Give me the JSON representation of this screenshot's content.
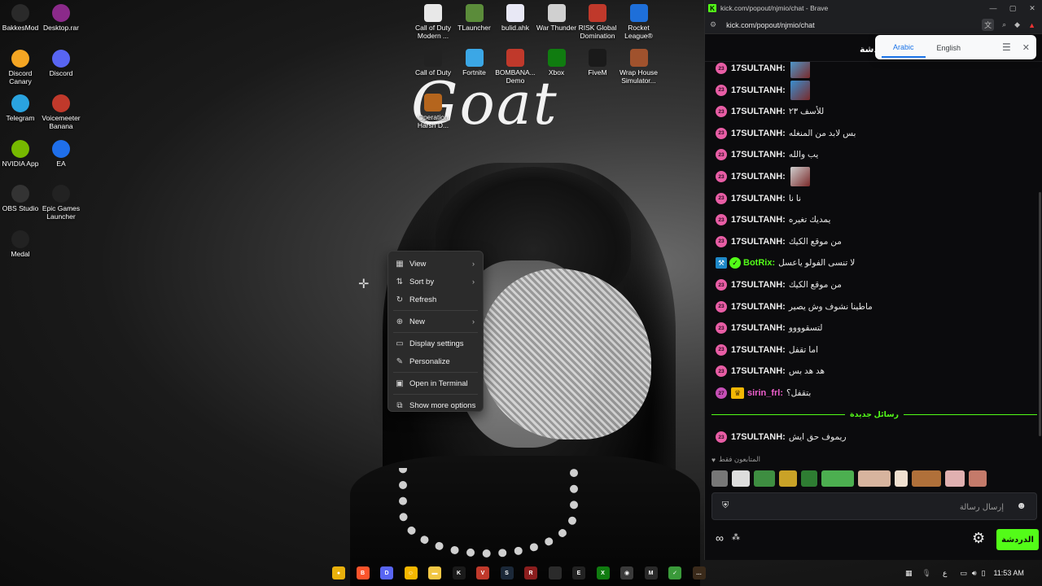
{
  "desktop": {
    "left_icons": [
      {
        "label": "BakkesMod",
        "icon": "bakkesmod-icon",
        "color": "#2a2a2a"
      },
      {
        "label": "Desktop.rar",
        "icon": "winrar-icon",
        "color": "#8b2a8a"
      },
      {
        "label": "Discord Canary",
        "icon": "discord-canary-icon",
        "color": "#f5a623"
      },
      {
        "label": "Discord",
        "icon": "discord-icon",
        "color": "#5865f2"
      },
      {
        "label": "Telegram",
        "icon": "telegram-icon",
        "color": "#2aa3df"
      },
      {
        "label": "Voicemeeter Banana",
        "icon": "voicemeeter-icon",
        "color": "#c0392b"
      },
      {
        "label": "NVIDIA App",
        "icon": "nvidia-icon",
        "color": "#76b900"
      },
      {
        "label": "EA",
        "icon": "ea-icon",
        "color": "#1f6feb"
      },
      {
        "label": "OBS Studio",
        "icon": "obs-icon",
        "color": "#333333"
      },
      {
        "label": "Epic Games Launcher",
        "icon": "epic-games-icon",
        "color": "#222222"
      },
      {
        "label": "Medal",
        "icon": "medal-icon",
        "color": "#222222"
      }
    ],
    "top_icons": [
      {
        "label": "Call of Duty Modern ...",
        "icon": "document-icon",
        "color": "#e8e8e8"
      },
      {
        "label": "TLauncher",
        "icon": "tlauncher-icon",
        "color": "#5b8c3a"
      },
      {
        "label": "bulid.ahk",
        "icon": "ahk-file-icon",
        "color": "#e8e8f5"
      },
      {
        "label": "War Thunder",
        "icon": "war-thunder-icon",
        "color": "#d0d0d0"
      },
      {
        "label": "RISK Global Domination",
        "icon": "risk-icon",
        "color": "#c0392b"
      },
      {
        "label": "Rocket League®",
        "icon": "rocket-league-icon",
        "color": "#1e6fd9"
      },
      {
        "label": "Call of Duty",
        "icon": "call-of-duty-icon",
        "color": "#222222"
      },
      {
        "label": "Fortnite",
        "icon": "fortnite-icon",
        "color": "#3ba7e6"
      },
      {
        "label": "BOMBANA... Demo",
        "icon": "bombana-icon",
        "color": "#c0392b"
      },
      {
        "label": "Xbox",
        "icon": "xbox-icon",
        "color": "#107c10"
      },
      {
        "label": "FiveM",
        "icon": "fivem-icon",
        "color": "#1a1a1a"
      },
      {
        "label": "Wrap House Simulator...",
        "icon": "wrap-house-icon",
        "color": "#a0522d"
      },
      {
        "label": "Operation Harsh D...",
        "icon": "operation-icon",
        "color": "#b5651d"
      }
    ],
    "wallpaper_text": "Goat"
  },
  "context_menu": {
    "items": [
      {
        "label": "View",
        "icon": "grid-icon",
        "glyph": "▦",
        "submenu": true
      },
      {
        "label": "Sort by",
        "icon": "sort-icon",
        "glyph": "⇅",
        "submenu": true
      },
      {
        "label": "Refresh",
        "icon": "refresh-icon",
        "glyph": "↻",
        "submenu": false
      },
      {
        "label": "New",
        "icon": "new-plus-icon",
        "glyph": "⊕",
        "submenu": true
      },
      {
        "label": "Display settings",
        "icon": "display-icon",
        "glyph": "▭",
        "submenu": false
      },
      {
        "label": "Personalize",
        "icon": "brush-icon",
        "glyph": "✎",
        "submenu": false
      },
      {
        "label": "Open in Terminal",
        "icon": "terminal-icon",
        "glyph": "▣",
        "submenu": false
      },
      {
        "label": "Show more options",
        "icon": "more-options-icon",
        "glyph": "⧉",
        "submenu": false
      }
    ]
  },
  "taskbar": {
    "clock": "11:53 AM",
    "lang": "ع",
    "apps": [
      {
        "icon": "chrome-icon",
        "color": "#e9b10c",
        "glyph": "●"
      },
      {
        "icon": "brave-icon",
        "color": "#fb542b",
        "glyph": "B"
      },
      {
        "icon": "discord-taskbar-icon",
        "color": "#5865f2",
        "glyph": "D"
      },
      {
        "icon": "emoji-app-icon",
        "color": "#f5b700",
        "glyph": "☺"
      },
      {
        "icon": "file-explorer-icon",
        "color": "#f2c744",
        "glyph": "▬"
      },
      {
        "icon": "kick-icon",
        "color": "#1a1a1a",
        "glyph": "K"
      },
      {
        "icon": "voicemeeter-taskbar-icon",
        "color": "#c0392b",
        "glyph": "V"
      },
      {
        "icon": "steam-icon",
        "color": "#1b2838",
        "glyph": "S"
      },
      {
        "icon": "risk-taskbar-icon",
        "color": "#8b1e1e",
        "glyph": "R"
      },
      {
        "icon": "blank-app-icon",
        "color": "#2b2b2b",
        "glyph": ""
      },
      {
        "icon": "epic-taskbar-icon",
        "color": "#222222",
        "glyph": "E"
      },
      {
        "icon": "xbox-taskbar-icon",
        "color": "#107c10",
        "glyph": "X"
      },
      {
        "icon": "obs-taskbar-icon",
        "color": "#3a3a3a",
        "glyph": "◉"
      },
      {
        "icon": "medal-taskbar-icon",
        "color": "#2a2a2a",
        "glyph": "M"
      },
      {
        "icon": "tlauncher-taskbar-icon",
        "color": "#3a9a3a",
        "glyph": "✓"
      },
      {
        "icon": "app-dots-icon",
        "color": "#3a2a1a",
        "glyph": "…"
      }
    ]
  },
  "browser": {
    "title": "kick.com/popout/njmio/chat - Brave",
    "url": "kick.com/popout/njmio/chat",
    "chat_header_title": "دشة",
    "translate": {
      "active": "Arabic",
      "other": "English"
    },
    "messages": [
      {
        "badge": "23",
        "user": "17SULTANH:",
        "text": "",
        "emote": true,
        "emote_color": "#4aa0d8"
      },
      {
        "badge": "23",
        "user": "17SULTANH:",
        "text": "",
        "emote": true,
        "emote_color": "#3a8fd0"
      },
      {
        "badge": "23",
        "user": "17SULTANH:",
        "text": "للأسف ٢٣",
        "emote": false
      },
      {
        "badge": "23",
        "user": "17SULTANH:",
        "text": "بس لابد من المنغله",
        "emote": false
      },
      {
        "badge": "23",
        "user": "17SULTANH:",
        "text": "يب والله",
        "emote": false
      },
      {
        "badge": "23",
        "user": "17SULTANH:",
        "text": "",
        "emote": true,
        "emote_color": "#cfcfcf"
      },
      {
        "badge": "23",
        "user": "17SULTANH:",
        "text": "نا نا",
        "emote": false
      },
      {
        "badge": "23",
        "user": "17SULTANH:",
        "text": "يمديك تغيره",
        "emote": false
      },
      {
        "badge": "23",
        "user": "17SULTANH:",
        "text": "من موقع الكيك",
        "emote": false
      },
      {
        "badge": "",
        "user": "BotRix:",
        "text": "لا تنسى الفولو ياعسل",
        "emote": false,
        "bot": true
      },
      {
        "badge": "23",
        "user": "17SULTANH:",
        "text": "من موقع الكيك",
        "emote": false
      },
      {
        "badge": "23",
        "user": "17SULTANH:",
        "text": "ماطينا نشوف وش يصير",
        "emote": false
      },
      {
        "badge": "23",
        "user": "17SULTANH:",
        "text": "لتسقوووو",
        "emote": false
      },
      {
        "badge": "23",
        "user": "17SULTANH:",
        "text": "اما تقفل",
        "emote": false
      },
      {
        "badge": "23",
        "user": "17SULTANH:",
        "text": "هد هد بس",
        "emote": false
      },
      {
        "badge": "27",
        "user": "sirin_frl:",
        "text": "بتقفل؟",
        "emote": false,
        "crown": true
      }
    ],
    "new_messages_label": "رسائل جديدة",
    "after_divider_message": {
      "badge": "23",
      "user": "17SULTANH:",
      "text": "ريموف حق ايش"
    },
    "followers_only": "المتابعون فقط",
    "emote_bar_colors": [
      "#777777",
      "#dddddd",
      "#3e8e41",
      "#c9a227",
      "#2e7d32",
      "#4caf50",
      "#d7b49e",
      "#f0e0d0",
      "#b0703a",
      "#e0b0b0",
      "#c47a6a"
    ],
    "input_placeholder": "إرسال رسالة",
    "send_label": "الدردشة"
  }
}
